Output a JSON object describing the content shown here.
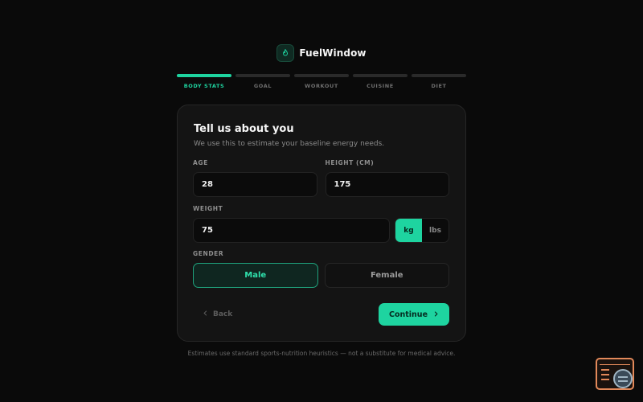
{
  "brand": {
    "name": "FuelWindow",
    "icon": "flame-icon",
    "accent": "#1ed4a0"
  },
  "steps": [
    {
      "label": "BODY STATS",
      "active": true
    },
    {
      "label": "GOAL",
      "active": false
    },
    {
      "label": "WORKOUT",
      "active": false
    },
    {
      "label": "CUISINE",
      "active": false
    },
    {
      "label": "DIET",
      "active": false
    }
  ],
  "card": {
    "title": "Tell us about you",
    "subtitle": "We use this to estimate your baseline energy needs."
  },
  "fields": {
    "age": {
      "label": "AGE",
      "value": "28"
    },
    "height": {
      "label": "HEIGHT (CM)",
      "value": "175"
    },
    "weight": {
      "label": "WEIGHT",
      "value": "75"
    },
    "units": {
      "kg": "kg",
      "lbs": "lbs",
      "selected": "kg"
    },
    "gender": {
      "label": "GENDER",
      "male": "Male",
      "female": "Female",
      "selected": "Male"
    }
  },
  "actions": {
    "back": "Back",
    "continue": "Continue"
  },
  "footer": "Estimates use standard sports-nutrition heuristics — not a substitute for medical advice."
}
